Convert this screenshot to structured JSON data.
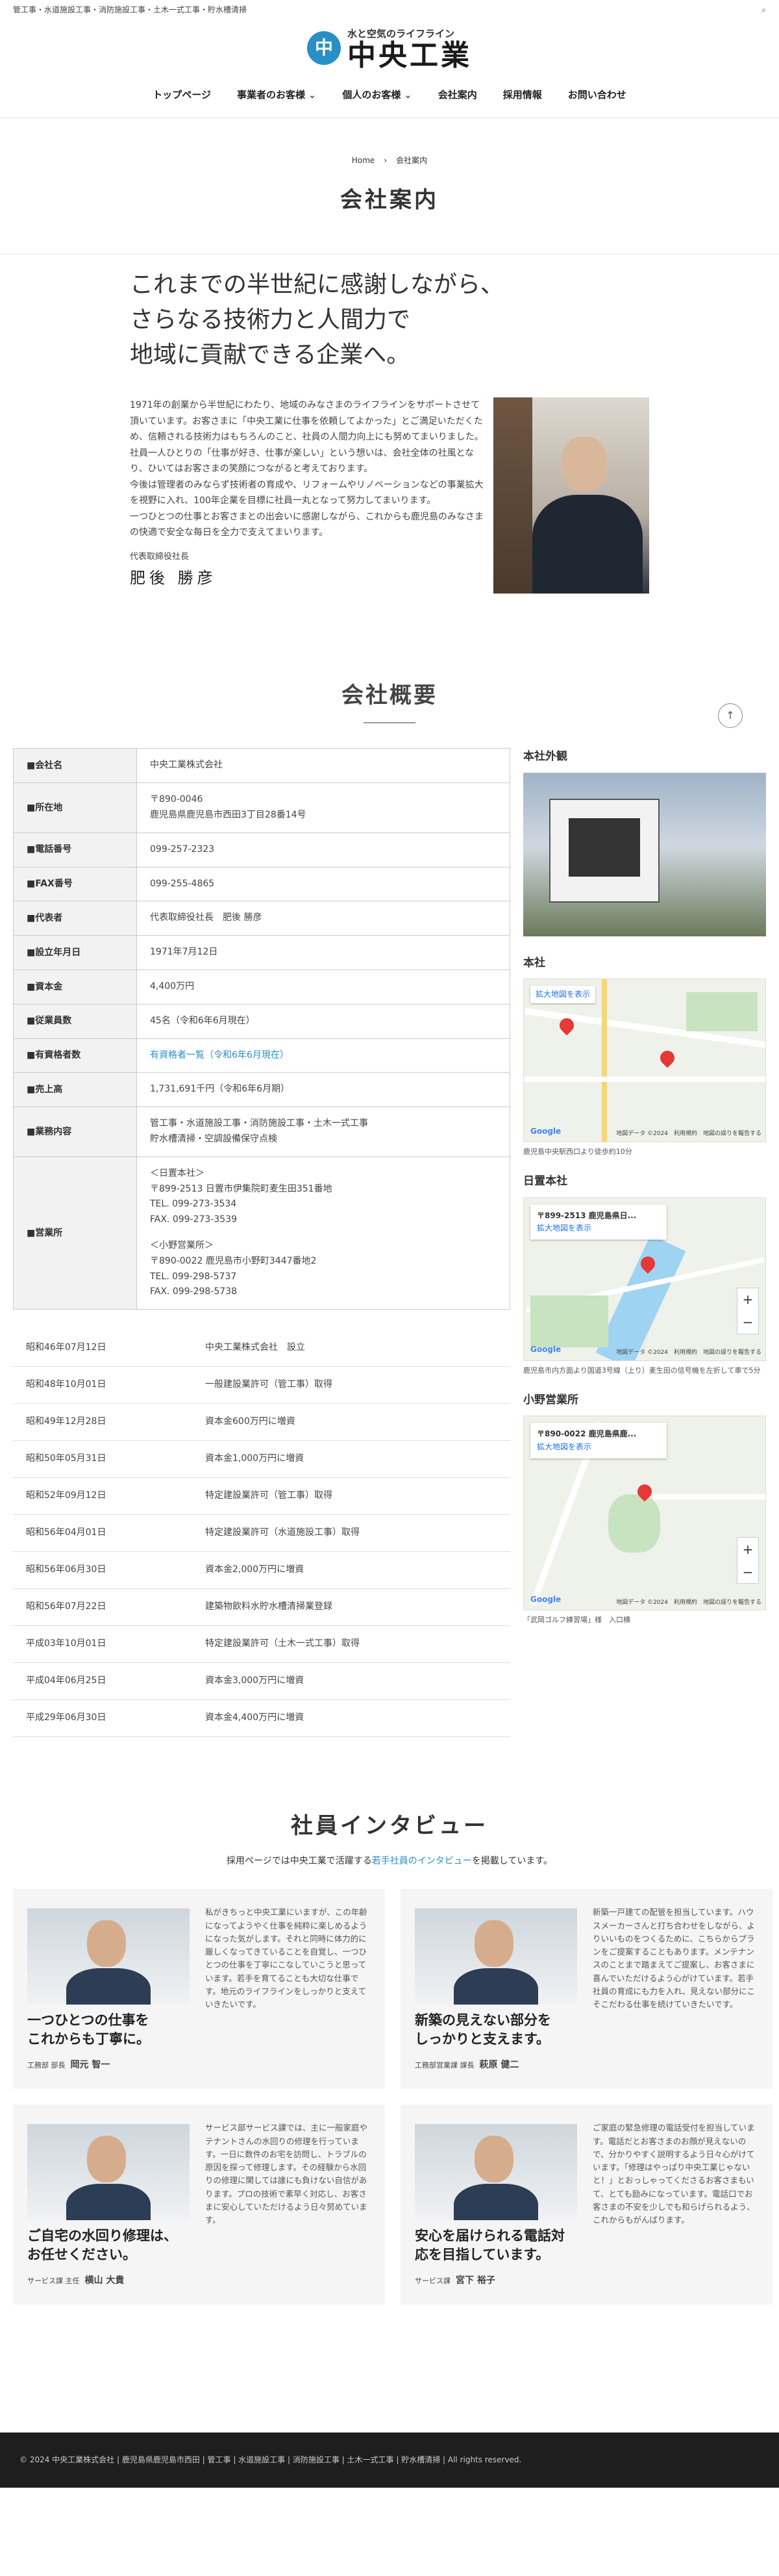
{
  "topbar": {
    "text": "管工事・水道施設工事・消防施設工事・土木一式工事・貯水槽清掃"
  },
  "logo": {
    "tagline": "水と空気のライフライン",
    "name": "中央工業"
  },
  "nav": [
    "トップページ",
    "事業者のお客様",
    "個人のお客様",
    "会社案内",
    "採用情報",
    "お問い合わせ"
  ],
  "breadcrumb": {
    "home": "Home",
    "current": "会社案内"
  },
  "page_title": "会社案内",
  "message": {
    "headline": [
      "これまでの半世紀に感謝しながら、",
      "さらなる技術力と人間力で",
      "地域に貢献できる企業へ。"
    ],
    "paragraphs": [
      "1971年の創業から半世紀にわたり、地域のみなさまのライフラインをサポートさせて頂いています。お客さまに「中央工業に仕事を依頼してよかった」とご満足いただくため、信頼される技術力はもちろんのこと、社員の人間力向上にも努めてまいりました。",
      "社員一人ひとりの「仕事が好き、仕事が楽しい」という想いは、会社全体の社風となり、ひいてはお客さまの笑顔につながると考えております。",
      "今後は管理者のみならず技術者の育成や、リフォームやリノベーションなどの事業拡大を視野に入れ、100年企業を目標に社員一丸となって努力してまいります。",
      "一つひとつの仕事とお客さまとの出会いに感謝しながら、これからも鹿児島のみなさまの快適で安全な毎日を全力で支えてまいります。"
    ],
    "sign_title": "代表取締役社長",
    "sign_name": "肥後 勝彦"
  },
  "overview_title": "会社概要",
  "company_info": [
    {
      "k": "■会社名",
      "v": [
        "中央工業株式会社"
      ]
    },
    {
      "k": "■所在地",
      "v": [
        "〒890-0046",
        "鹿児島県鹿児島市西田3丁目28番14号"
      ]
    },
    {
      "k": "■電話番号",
      "v": [
        "099-257-2323"
      ]
    },
    {
      "k": "■FAX番号",
      "v": [
        "099-255-4865"
      ]
    },
    {
      "k": "■代表者",
      "v": [
        "代表取締役社長　肥後 勝彦"
      ]
    },
    {
      "k": "■設立年月日",
      "v": [
        "1971年7月12日"
      ]
    },
    {
      "k": "■資本金",
      "v": [
        "4,400万円"
      ]
    },
    {
      "k": "■従業員数",
      "v": [
        "45名（令和6年6月現在）"
      ]
    },
    {
      "k": "■有資格者数",
      "v": [
        "有資格者一覧（令和6年6月現在）"
      ]
    },
    {
      "k": "■売上高",
      "v": [
        "1,731,691千円（令和6年6月期）"
      ]
    },
    {
      "k": "■業務内容",
      "v": [
        "管工事・水道施設工事・消防施設工事・土木一式工事",
        "貯水槽清掃・空調設備保守点検"
      ]
    },
    {
      "k": "■営業所",
      "v": [
        "＜日置本社＞",
        "〒899-2513 日置市伊集院町麦生田351番地",
        "TEL. 099-273-3534",
        "FAX. 099-273-3539",
        "",
        "＜小野営業所＞",
        "〒890-0022 鹿児島市小野町3447番地2",
        "TEL. 099-298-5737",
        "FAX. 099-298-5738"
      ]
    }
  ],
  "history": [
    {
      "d": "昭和46年07月12日",
      "e": "中央工業株式会社　設立"
    },
    {
      "d": "昭和48年10月01日",
      "e": "一般建設業許可（管工事）取得"
    },
    {
      "d": "昭和49年12月28日",
      "e": "資本金600万円に増資"
    },
    {
      "d": "昭和50年05月31日",
      "e": "資本金1,000万円に増資"
    },
    {
      "d": "昭和52年09月12日",
      "e": "特定建設業許可（管工事）取得"
    },
    {
      "d": "昭和56年04月01日",
      "e": "特定建設業許可（水道施設工事）取得"
    },
    {
      "d": "昭和56年06月30日",
      "e": "資本金2,000万円に増資"
    },
    {
      "d": "昭和56年07月22日",
      "e": "建築物飲料水貯水槽清掃業登録"
    },
    {
      "d": "平成03年10月01日",
      "e": "特定建設業許可（土木一式工事）取得"
    },
    {
      "d": "平成04年06月25日",
      "e": "資本金3,000万円に増資"
    },
    {
      "d": "平成29年06月30日",
      "e": "資本金4,400万円に増資"
    }
  ],
  "sidebar": {
    "exterior": "本社外観",
    "hq": {
      "title": "本社",
      "card_link": "拡大地図を表示",
      "note": "鹿児島中央駅西口より徒歩約10分",
      "map_credit": "地図データ ©2024　利用規約　地図の誤りを報告する"
    },
    "hioki": {
      "title": "日置本社",
      "card_title": "〒899-2513 鹿児島県日...",
      "card_link": "拡大地図を表示",
      "note": "鹿児島市内方面より国道3号線（上り）麦生田の信号機を左折して車で5分",
      "map_credit": "地図データ ©2024　利用規約　地図の誤りを報告する"
    },
    "ono": {
      "title": "小野営業所",
      "card_title": "〒890-0022 鹿児島県鹿...",
      "card_link": "拡大地図を表示",
      "note": "「武岡ゴルフ練習場」様　入口横",
      "map_credit": "地図データ ©2024　利用規約　地図の誤りを報告する"
    },
    "google": "Google"
  },
  "interview": {
    "title": "社員インタビュー",
    "sub_before": "採用ページでは中央工業で活躍する",
    "sub_link": "若手社員のインタビュー",
    "sub_after": "を掲載しています。",
    "cards": [
      {
        "title": "一つひとつの仕事を\nこれからも丁寧に。",
        "role": "工務部 部長",
        "name": "岡元 智一",
        "text": "私がきちっと中央工業にいますが、この年齢になってようやく仕事を純粋に楽しめるようになった気がします。それと同時に体力的に厳しくなってきていることを自覚し、一つひとつの仕事を丁寧にこなしていこうと思っています。若手を育てることも大切な仕事です。地元のライフラインをしっかりと支えていきたいです。"
      },
      {
        "title": "新築の見えない部分を\nしっかりと支えます。",
        "role": "工務部営業課 課長",
        "name": "萩原 健二",
        "text": "新築一戸建ての配管を担当しています。ハウスメーカーさんと打ち合わせをしながら、よりいいものをつくるために、こちらからプランをご提案することもあります。メンテナンスのことまで踏まえてご提案し、お客さまに喜んでいただけるよう心がけています。若手社員の育成にも力を入れ、見えない部分にこそこだわる仕事を続けていきたいです。"
      },
      {
        "title": "ご自宅の水回り修理は、\nお任せください。",
        "role": "サービス課 主任",
        "name": "横山 大貴",
        "text": "サービス部サービス課では、主に一般家庭やテナントさんの水回りの修理を行っています。一日に数件のお宅を訪問し、トラブルの原因を探って修理します。その経験から水回りの修理に関しては誰にも負けない自信があります。プロの技術で素早く対応し、お客さまに安心していただけるよう日々努めています。"
      },
      {
        "title": "安心を届けられる電話対\n応を目指しています。",
        "role": "サービス課",
        "name": "宮下 裕子",
        "text": "ご家庭の緊急修理の電話受付を担当しています。電話だとお客さまのお顔が見えないので、分かりやすく説明するよう日々心がけています。「修理はやっぱり中央工業じゃないと！」とおっしゃってくださるお客さまもいて、とても励みになっています。電話口でお客さまの不安を少しでも和らげられるよう、これからもがんばります。"
      }
    ]
  },
  "footer": {
    "text": "© 2024 中央工業株式会社 | 鹿児島県鹿児島市西田 | 管工事 | 水道施設工事 | 消防施設工事 | 土木一式工事 | 貯水槽清掃 | All rights reserved."
  }
}
